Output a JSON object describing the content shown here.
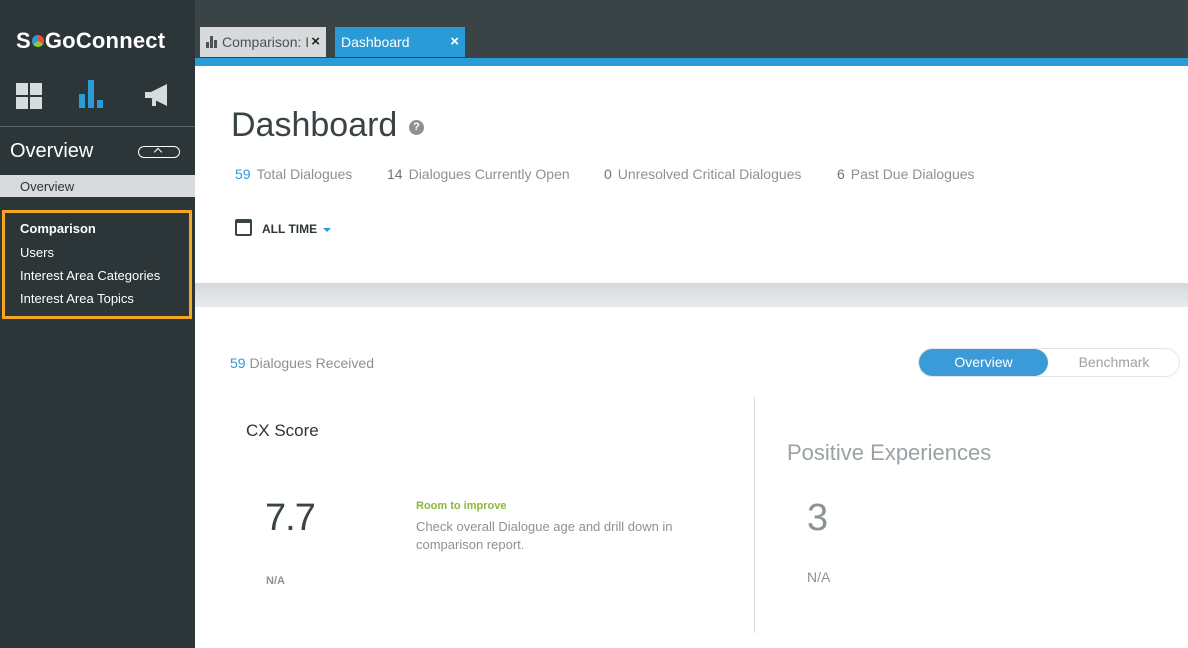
{
  "app": {
    "logo_text_left": "S",
    "logo_text_right": "GoConnect"
  },
  "sidebar": {
    "module_icons": [
      "dashboard-grid-icon",
      "bar-chart-icon",
      "megaphone-icon"
    ],
    "section_title": "Overview",
    "overview_item": "Overview",
    "items": [
      {
        "label": "Comparison",
        "active": true
      },
      {
        "label": "Users",
        "active": false
      },
      {
        "label": "Interest Area Categories",
        "active": false
      },
      {
        "label": "Interest Area Topics",
        "active": false
      }
    ]
  },
  "tabs": [
    {
      "label": "Comparison: I",
      "icon": "bar-chart-icon",
      "active": false,
      "close": "×"
    },
    {
      "label": "Dashboard",
      "active": true,
      "close": "×"
    }
  ],
  "header": {
    "title": "Dashboard",
    "help": "?",
    "stats": [
      {
        "value": "59",
        "label": "Total Dialogues"
      },
      {
        "value": "14",
        "label": "Dialogues Currently Open"
      },
      {
        "value": "0",
        "label": "Unresolved Critical Dialogues"
      },
      {
        "value": "6",
        "label": "Past Due Dialogues"
      }
    ],
    "date_filter": "ALL TIME"
  },
  "summary": {
    "received_count": "59",
    "received_label": " Dialogues Received",
    "toggle": {
      "active": "Overview",
      "inactive": "Benchmark"
    }
  },
  "cx": {
    "title": "CX Score",
    "score": "7.7",
    "na": "N/A",
    "hint_title": "Room to improve",
    "hint_text": "Check overall Dialogue age and drill down in comparison report."
  },
  "positive": {
    "title": "Positive Experiences",
    "value": "3",
    "na": "N/A"
  },
  "colors": {
    "sidebar_bg": "#2c3538",
    "accent_blue": "#2a9bd6",
    "highlight_orange": "#f5a623",
    "hint_green": "#8cb83a"
  }
}
